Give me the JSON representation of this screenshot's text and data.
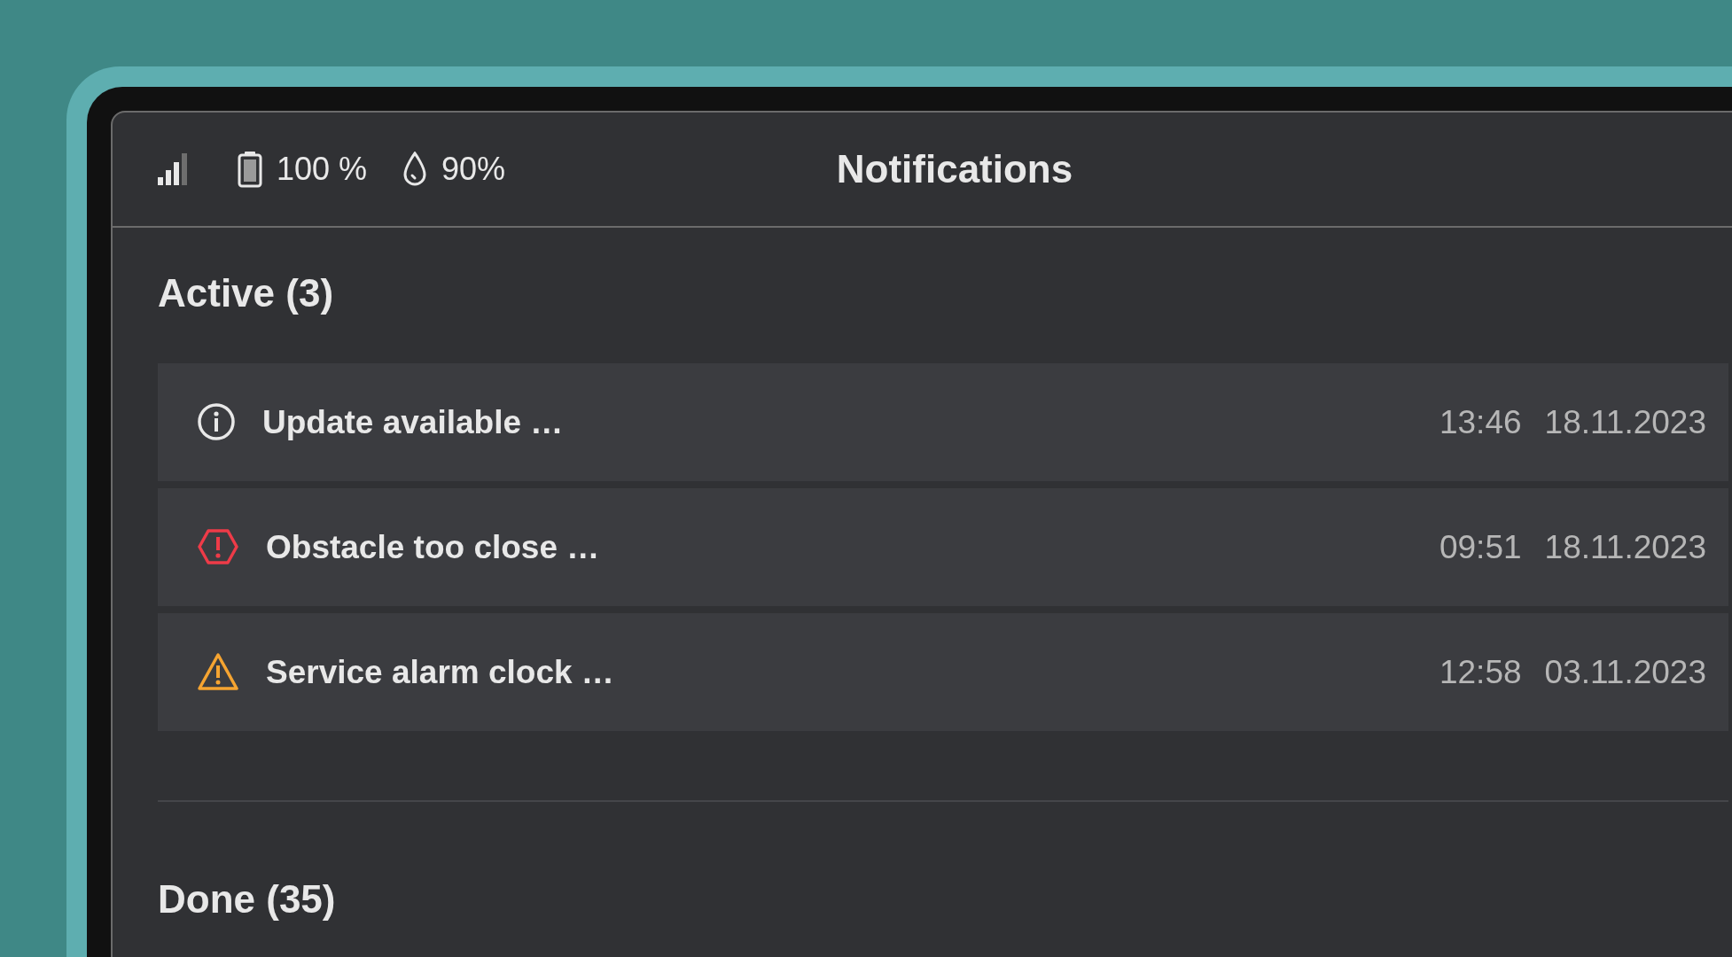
{
  "status_bar": {
    "battery": "100 %",
    "humidity": "90%"
  },
  "title": "Notifications",
  "sections": [
    {
      "heading": "Active (3)",
      "notifications": [
        {
          "kind": "info",
          "message": "Update available …",
          "time": "13:46",
          "date": "18.11.2023"
        },
        {
          "kind": "error",
          "message": "Obstacle too close …",
          "time": "09:51",
          "date": "18.11.2023"
        },
        {
          "kind": "warning",
          "message": "Service alarm clock …",
          "time": "12:58",
          "date": "03.11.2023"
        }
      ]
    },
    {
      "heading": "Done (35)"
    }
  ]
}
